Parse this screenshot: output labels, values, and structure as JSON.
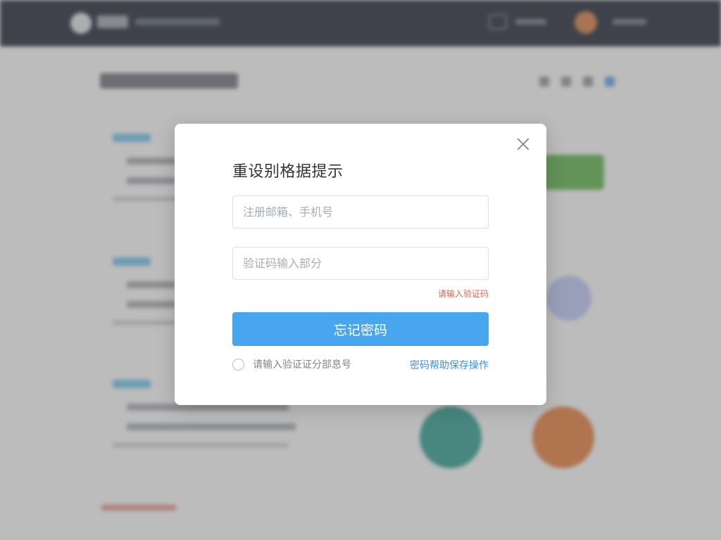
{
  "modal": {
    "title": "重设别格据提示",
    "account_placeholder": "注册邮箱、手机号",
    "code_placeholder": "验证码输入部分",
    "error_hint": "请输入验证码",
    "submit_label": "忘记密码",
    "remember_label": "请输入验证证分部息号",
    "side_link": "密码帮助保存操作"
  },
  "colors": {
    "primary": "#47a6ee",
    "error": "#e0644f",
    "link": "#3d8fe0",
    "topbar": "#1e2432"
  }
}
